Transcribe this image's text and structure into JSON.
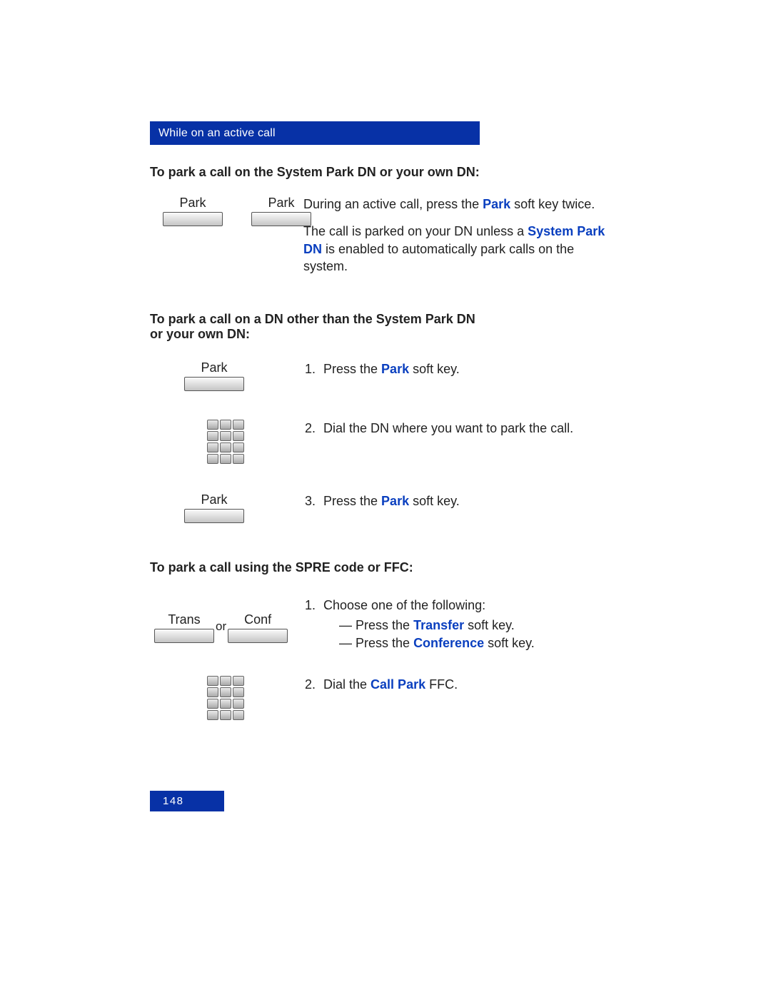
{
  "header": {
    "title": "While on an active call"
  },
  "section1": {
    "heading": "To park a call on the System Park DN or your own DN:",
    "key1": "Park",
    "key2": "Park",
    "line1a": "During an active call, press the ",
    "line1_park": "Park",
    "line1b": " soft key twice.",
    "line2a": "The call is parked on your DN unless a ",
    "line2_spdn": "System Park DN",
    "line2b": " is enabled to automatically park calls on the system."
  },
  "section2": {
    "heading": "To park a call on a DN other than the System Park DN or your own DN:",
    "key1": "Park",
    "key2": "Park",
    "step1a": "Press the ",
    "step1_park": "Park",
    "step1b": " soft key.",
    "step2": "Dial the DN where you want to park the call.",
    "step3a": "Press the ",
    "step3_park": "Park",
    "step3b": " soft key."
  },
  "section3": {
    "heading": "To park a call using the SPRE code or FFC:",
    "key1": "Trans",
    "or": "or",
    "key2": "Conf",
    "step1": "Choose one of the following:",
    "bullet1a": "Press the ",
    "bullet1_transfer": "Transfer",
    "bullet1b": " soft key.",
    "bullet2a": "Press the ",
    "bullet2_conference": "Conference",
    "bullet2b": " soft key.",
    "step2a": "Dial the ",
    "step2_callpark": "Call Park",
    "step2b": " FFC."
  },
  "footer": {
    "page_number": "148"
  }
}
